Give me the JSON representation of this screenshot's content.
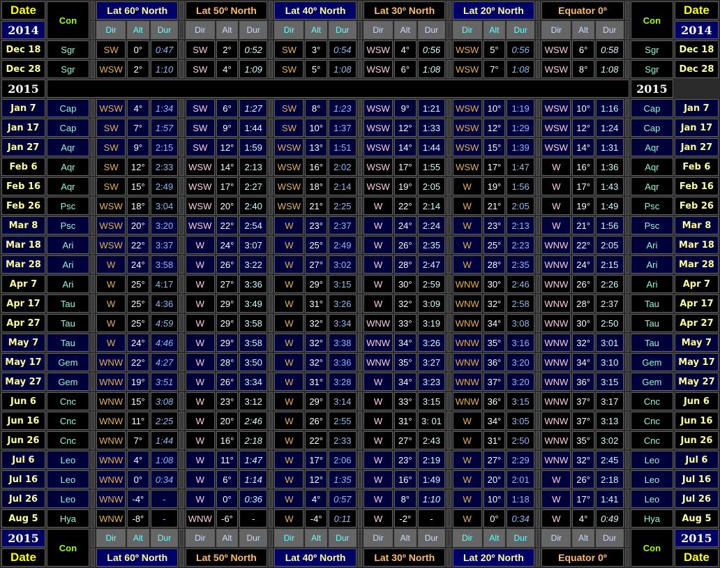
{
  "header": {
    "date_label": "Date",
    "con_label": "Con",
    "year_top": "2014",
    "year_mid": "2015",
    "year_bottom": "2015",
    "sub_labels": [
      "Dir",
      "Alt",
      "Dur"
    ],
    "latitudes": [
      "Lat 60º North",
      "Lat 50º North",
      "Lat 40º North",
      "Lat 30º North",
      "Lat 20º North",
      "Equator 0º"
    ]
  },
  "rows_2014": [
    {
      "date": "Dec 18",
      "con": "Sgr",
      "cells": [
        [
          "SW",
          "0°",
          "0:47"
        ],
        [
          "SW",
          "2°",
          "0:52"
        ],
        [
          "SW",
          "3°",
          "0:54"
        ],
        [
          "WSW",
          "4°",
          "0:56"
        ],
        [
          "WSW",
          "5°",
          "0:56"
        ],
        [
          "WSW",
          "6°",
          "0:58"
        ]
      ],
      "ital": [
        1,
        1,
        1,
        1,
        1,
        1
      ]
    },
    {
      "date": "Dec 28",
      "con": "Sgr",
      "cells": [
        [
          "WSW",
          "2°",
          "1:10"
        ],
        [
          "SW",
          "4°",
          "1:09"
        ],
        [
          "SW",
          "5°",
          "1:08"
        ],
        [
          "WSW",
          "6°",
          "1:08"
        ],
        [
          "WSW",
          "7°",
          "1:08"
        ],
        [
          "WSW",
          "8°",
          "1:08"
        ]
      ],
      "ital": [
        1,
        1,
        1,
        1,
        1,
        1
      ]
    }
  ],
  "rows_2015": [
    {
      "date": "Jan 7",
      "con": "Cap",
      "cells": [
        [
          "WSW",
          "4°",
          "1:34"
        ],
        [
          "SW",
          "6°",
          "1:27"
        ],
        [
          "SW",
          "8°",
          "1:23"
        ],
        [
          "WSW",
          "9°",
          "1:21"
        ],
        [
          "WSW",
          "10°",
          "1:19"
        ],
        [
          "WSW",
          "10°",
          "1:16"
        ]
      ],
      "ital": [
        1,
        1,
        1,
        0,
        0,
        0
      ]
    },
    {
      "date": "Jan 17",
      "con": "Cap",
      "cells": [
        [
          "SW",
          "7°",
          "1:57"
        ],
        [
          "SW",
          "9°",
          "1:44"
        ],
        [
          "SW",
          "10°",
          "1:37"
        ],
        [
          "WSW",
          "12°",
          "1:33"
        ],
        [
          "WSW",
          "12°",
          "1:29"
        ],
        [
          "WSW",
          "12°",
          "1:24"
        ]
      ],
      "ital": [
        1,
        0,
        0,
        0,
        0,
        0
      ]
    },
    {
      "date": "Jan 27",
      "con": "Aqr",
      "cells": [
        [
          "SW",
          "9°",
          "2:15"
        ],
        [
          "SW",
          "12°",
          "1:59"
        ],
        [
          "WSW",
          "13°",
          "1:51"
        ],
        [
          "WSW",
          "14°",
          "1:44"
        ],
        [
          "WSW",
          "15°",
          "1:39"
        ],
        [
          "WSW",
          "14°",
          "1:31"
        ]
      ],
      "ital": [
        0,
        0,
        0,
        0,
        0,
        0
      ]
    },
    {
      "date": "Feb 6",
      "con": "Aqr",
      "cells": [
        [
          "SW",
          "12°",
          "2:33"
        ],
        [
          "WSW",
          "14°",
          "2:13"
        ],
        [
          "WSW",
          "16°",
          "2:02"
        ],
        [
          "WSW",
          "17°",
          "1:55"
        ],
        [
          "WSW",
          "17°",
          "1:47"
        ],
        [
          "W",
          "16°",
          "1:36"
        ]
      ],
      "ital": [
        0,
        0,
        0,
        0,
        0,
        0
      ]
    },
    {
      "date": "Feb 16",
      "con": "Aqr",
      "cells": [
        [
          "SW",
          "15°",
          "2:49"
        ],
        [
          "WSW",
          "17°",
          "2:27"
        ],
        [
          "WSW",
          "18°",
          "2:14"
        ],
        [
          "WSW",
          "19°",
          "2:05"
        ],
        [
          "W",
          "19°",
          "1:56"
        ],
        [
          "W",
          "17°",
          "1:43"
        ]
      ],
      "ital": [
        0,
        0,
        0,
        0,
        0,
        0
      ]
    },
    {
      "date": "Feb 26",
      "con": "Psc",
      "cells": [
        [
          "WSW",
          "18°",
          "3:04"
        ],
        [
          "WSW",
          "20°",
          "2:40"
        ],
        [
          "WSW",
          "21°",
          "2:25"
        ],
        [
          "W",
          "22°",
          "2:14"
        ],
        [
          "W",
          "21°",
          "2:05"
        ],
        [
          "W",
          "19°",
          "1:49"
        ]
      ],
      "ital": [
        0,
        0,
        0,
        0,
        0,
        0
      ]
    },
    {
      "date": "Mar 8",
      "con": "Psc",
      "cells": [
        [
          "WSW",
          "20°",
          "3:20"
        ],
        [
          "WSW",
          "22°",
          "2:54"
        ],
        [
          "W",
          "23°",
          "2:37"
        ],
        [
          "W",
          "24°",
          "2:24"
        ],
        [
          "W",
          "23°",
          "2:13"
        ],
        [
          "W",
          "21°",
          "1:56"
        ]
      ],
      "ital": [
        0,
        0,
        0,
        0,
        0,
        0
      ]
    },
    {
      "date": "Mar 18",
      "con": "Ari",
      "cells": [
        [
          "WSW",
          "22°",
          "3:37"
        ],
        [
          "W",
          "24°",
          "3:07"
        ],
        [
          "W",
          "25°",
          "2:49"
        ],
        [
          "W",
          "26°",
          "2:35"
        ],
        [
          "W",
          "25°",
          "2:23"
        ],
        [
          "WNW",
          "22°",
          "2:05"
        ]
      ],
      "ital": [
        0,
        0,
        0,
        0,
        0,
        0
      ]
    },
    {
      "date": "Mar 28",
      "con": "Ari",
      "cells": [
        [
          "W",
          "24°",
          "3:58"
        ],
        [
          "W",
          "26°",
          "3:22"
        ],
        [
          "W",
          "27°",
          "3:02"
        ],
        [
          "W",
          "28°",
          "2:47"
        ],
        [
          "W",
          "28°",
          "2:35"
        ],
        [
          "WNW",
          "24°",
          "2:15"
        ]
      ],
      "ital": [
        0,
        0,
        0,
        0,
        0,
        0
      ]
    },
    {
      "date": "Apr 7",
      "con": "Ari",
      "cells": [
        [
          "W",
          "25°",
          "4:17"
        ],
        [
          "W",
          "27°",
          "3:36"
        ],
        [
          "W",
          "29°",
          "3:15"
        ],
        [
          "W",
          "30°",
          "2:59"
        ],
        [
          "WNW",
          "30°",
          "2:46"
        ],
        [
          "WNW",
          "26°",
          "2:26"
        ]
      ],
      "ital": [
        0,
        0,
        0,
        0,
        0,
        0
      ]
    },
    {
      "date": "Apr 17",
      "con": "Tau",
      "cells": [
        [
          "W",
          "25°",
          "4:36"
        ],
        [
          "W",
          "29°",
          "3:49"
        ],
        [
          "W",
          "31°",
          "3:26"
        ],
        [
          "W",
          "32°",
          "3:09"
        ],
        [
          "WNW",
          "32°",
          "2:58"
        ],
        [
          "WNW",
          "28°",
          "2:37"
        ]
      ],
      "ital": [
        0,
        0,
        0,
        0,
        0,
        0
      ]
    },
    {
      "date": "Apr 27",
      "con": "Tau",
      "cells": [
        [
          "W",
          "25°",
          "4:59"
        ],
        [
          "W",
          "29°",
          "3:58"
        ],
        [
          "W",
          "32°",
          "3:34"
        ],
        [
          "WNW",
          "33°",
          "3:19"
        ],
        [
          "WNW",
          "34°",
          "3:08"
        ],
        [
          "WNW",
          "30°",
          "2:50"
        ]
      ],
      "ital": [
        1,
        0,
        0,
        0,
        0,
        0
      ]
    },
    {
      "date": "May 7",
      "con": "Tau",
      "cells": [
        [
          "W",
          "24°",
          "4:46"
        ],
        [
          "W",
          "29°",
          "3:58"
        ],
        [
          "W",
          "32°",
          "3:38"
        ],
        [
          "WNW",
          "34°",
          "3:26"
        ],
        [
          "WNW",
          "35°",
          "3:16"
        ],
        [
          "WNW",
          "32°",
          "3:01"
        ]
      ],
      "ital": [
        1,
        0,
        0,
        0,
        0,
        0
      ]
    },
    {
      "date": "May 17",
      "con": "Gem",
      "cells": [
        [
          "WNW",
          "22°",
          "4:27"
        ],
        [
          "W",
          "28°",
          "3:50"
        ],
        [
          "W",
          "32°",
          "3:36"
        ],
        [
          "WNW",
          "35°",
          "3:27"
        ],
        [
          "WNW",
          "36°",
          "3:20"
        ],
        [
          "WNW",
          "34°",
          "3:10"
        ]
      ],
      "ital": [
        1,
        0,
        0,
        0,
        0,
        0
      ]
    },
    {
      "date": "May 27",
      "con": "Gem",
      "cells": [
        [
          "WNW",
          "19°",
          "3:51"
        ],
        [
          "W",
          "26°",
          "3:34"
        ],
        [
          "W",
          "31°",
          "3:28"
        ],
        [
          "W",
          "34°",
          "3:23"
        ],
        [
          "WNW",
          "37°",
          "3:20"
        ],
        [
          "WNW",
          "36°",
          "3:15"
        ]
      ],
      "ital": [
        1,
        0,
        0,
        0,
        0,
        0
      ]
    },
    {
      "date": "Jun 6",
      "con": "Cnc",
      "cells": [
        [
          "WNW",
          "15°",
          "3:08"
        ],
        [
          "W",
          "23°",
          "3:12"
        ],
        [
          "W",
          "29°",
          "3:14"
        ],
        [
          "W",
          "33°",
          "3:15"
        ],
        [
          "WNW",
          "36°",
          "3:15"
        ],
        [
          "WNW",
          "37°",
          "3:17"
        ]
      ],
      "ital": [
        1,
        0,
        0,
        0,
        0,
        0
      ]
    },
    {
      "date": "Jun 16",
      "con": "Cnc",
      "cells": [
        [
          "WNW",
          "11°",
          "2:25"
        ],
        [
          "W",
          "20°",
          "2:46"
        ],
        [
          "W",
          "26°",
          "2:55"
        ],
        [
          "W",
          "31°",
          "3: 01"
        ],
        [
          "W",
          "34°",
          "3:05"
        ],
        [
          "WNW",
          "37°",
          "3:13"
        ]
      ],
      "ital": [
        1,
        1,
        0,
        0,
        0,
        0
      ]
    },
    {
      "date": "Jun 26",
      "con": "Cnc",
      "cells": [
        [
          "WNW",
          "7°",
          "1:44"
        ],
        [
          "W",
          "16°",
          "2:18"
        ],
        [
          "W",
          "22°",
          "2:33"
        ],
        [
          "W",
          "27°",
          "2:43"
        ],
        [
          "W",
          "31°",
          "2:50"
        ],
        [
          "WNW",
          "35°",
          "3:02"
        ]
      ],
      "ital": [
        1,
        1,
        0,
        0,
        0,
        0
      ]
    },
    {
      "date": "Jul 6",
      "con": "Leo",
      "cells": [
        [
          "WNW",
          "4°",
          "1:08"
        ],
        [
          "W",
          "11°",
          "1:47"
        ],
        [
          "W",
          "17°",
          "2:06"
        ],
        [
          "W",
          "23°",
          "2:19"
        ],
        [
          "W",
          "27°",
          "2:29"
        ],
        [
          "WNW",
          "32°",
          "2:45"
        ]
      ],
      "ital": [
        1,
        1,
        0,
        0,
        0,
        0
      ]
    },
    {
      "date": "Jul 16",
      "con": "Leo",
      "cells": [
        [
          "WNW",
          "0°",
          "0:34"
        ],
        [
          "W",
          "6°",
          "1:14"
        ],
        [
          "W",
          "12°",
          "1:35"
        ],
        [
          "W",
          "16°",
          "1:49"
        ],
        [
          "W",
          "20°",
          "2:01"
        ],
        [
          "W",
          "26°",
          "2:18"
        ]
      ],
      "ital": [
        1,
        1,
        1,
        0,
        0,
        0
      ]
    },
    {
      "date": "Jul 26",
      "con": "Leo",
      "cells": [
        [
          "WNW",
          "-4°",
          "-"
        ],
        [
          "W",
          "0°",
          "0:36"
        ],
        [
          "W",
          "4°",
          "0:57"
        ],
        [
          "W",
          "8°",
          "1:10"
        ],
        [
          "W",
          "10°",
          "1:18"
        ],
        [
          "W",
          "17°",
          "1:41"
        ]
      ],
      "ital": [
        0,
        1,
        1,
        1,
        0,
        0
      ]
    },
    {
      "date": "Aug 5",
      "con": "Hya",
      "cells": [
        [
          "WNW",
          "-8°",
          "-"
        ],
        [
          "WNW",
          "-6°",
          "-"
        ],
        [
          "W",
          "-4°",
          "0:11"
        ],
        [
          "W",
          "-2°",
          "-"
        ],
        [
          "W",
          "0°",
          "0:34"
        ],
        [
          "W",
          "4°",
          "0:49"
        ]
      ],
      "ital": [
        0,
        0,
        1,
        0,
        1,
        1
      ]
    }
  ],
  "row_shading_2015": [
    "blue",
    "blue",
    "blue",
    "blk",
    "blk",
    "blk",
    "blue",
    "blue",
    "blue",
    "blk",
    "blk",
    "blk",
    "blue",
    "blue",
    "blue",
    "blk",
    "blk",
    "blk",
    "blue",
    "blue",
    "blue",
    "blk"
  ]
}
